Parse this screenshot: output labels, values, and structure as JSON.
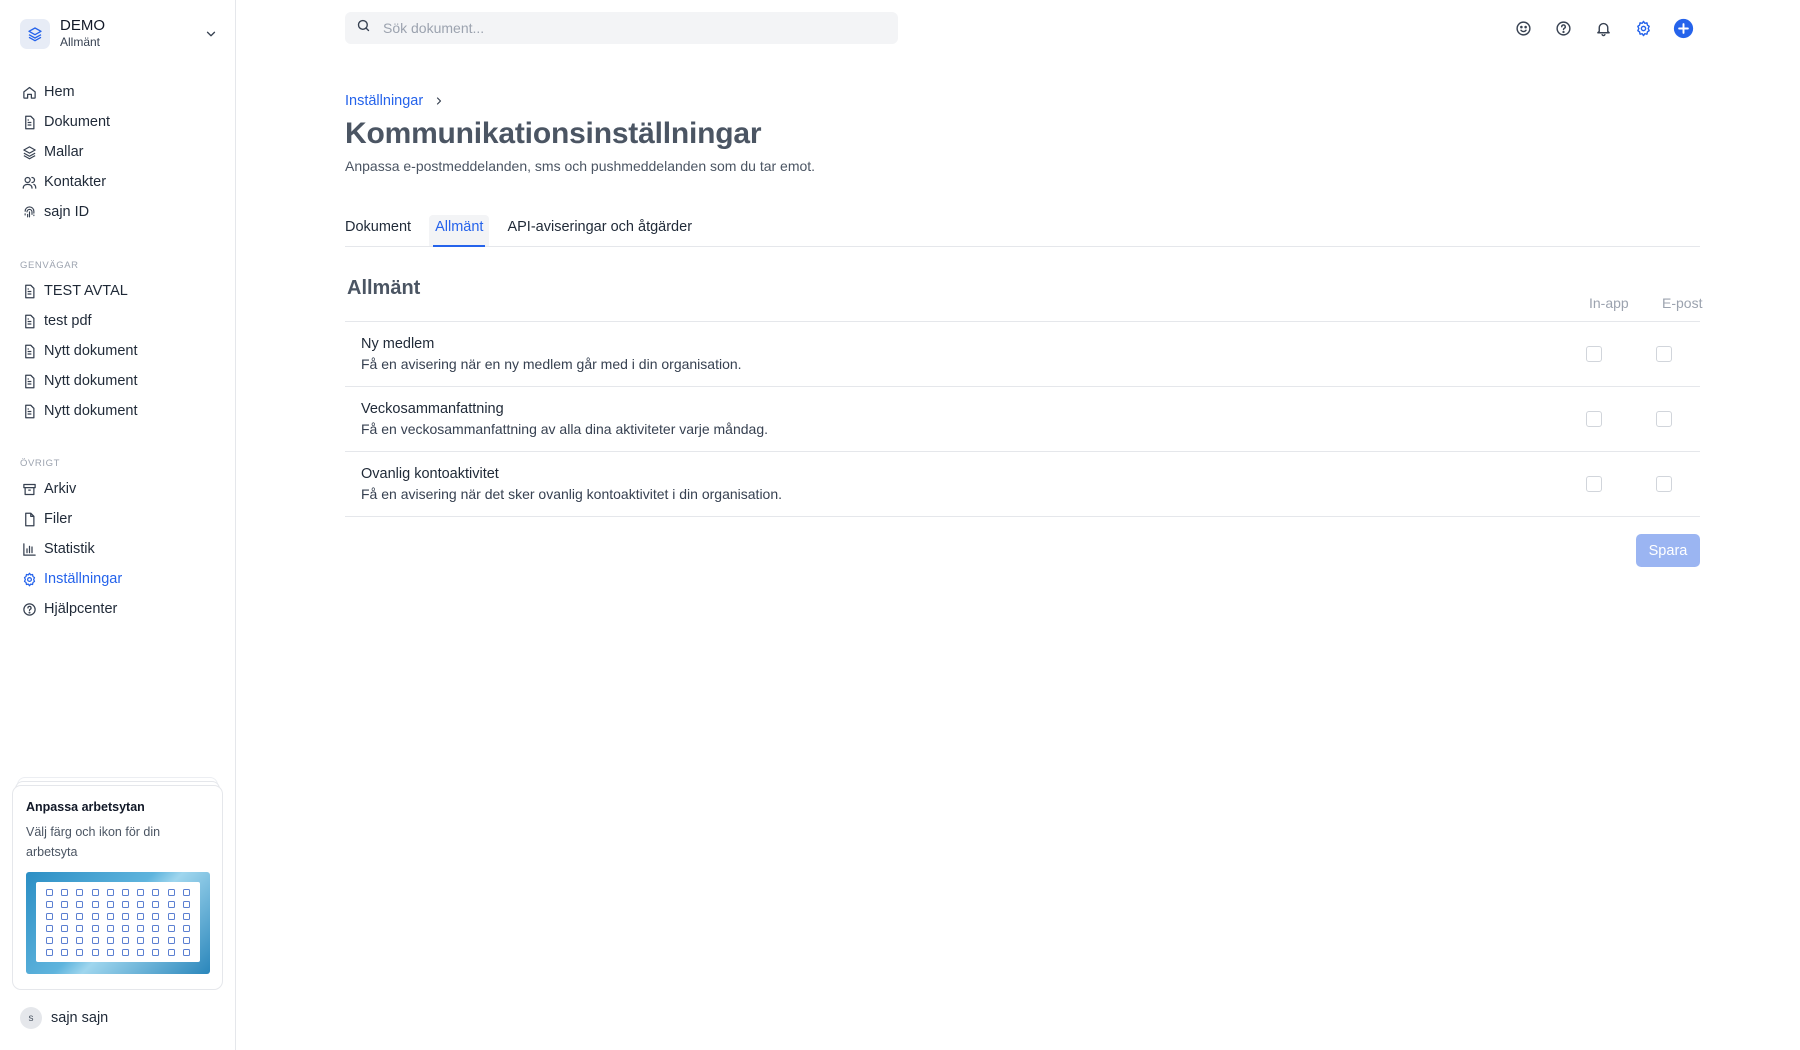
{
  "workspace": {
    "name": "DEMO",
    "subtitle": "Allmänt"
  },
  "nav": {
    "main": [
      {
        "label": "Hem",
        "icon": "home-icon"
      },
      {
        "label": "Dokument",
        "icon": "document-icon"
      },
      {
        "label": "Mallar",
        "icon": "layers-icon"
      },
      {
        "label": "Kontakter",
        "icon": "users-icon"
      },
      {
        "label": "sajn ID",
        "icon": "fingerprint-icon"
      }
    ],
    "shortcuts_label": "GENVÄGAR",
    "shortcuts": [
      {
        "label": "TEST AVTAL"
      },
      {
        "label": "test pdf"
      },
      {
        "label": "Nytt dokument"
      },
      {
        "label": "Nytt dokument"
      },
      {
        "label": "Nytt dokument"
      }
    ],
    "other_label": "ÖVRIGT",
    "other": [
      {
        "label": "Arkiv",
        "icon": "archive-icon"
      },
      {
        "label": "Filer",
        "icon": "file-icon"
      },
      {
        "label": "Statistik",
        "icon": "bar-chart-icon"
      },
      {
        "label": "Inställningar",
        "icon": "gear-icon",
        "active": true
      },
      {
        "label": "Hjälpcenter",
        "icon": "help-circle-icon"
      }
    ]
  },
  "promo": {
    "title": "Anpassa arbetsytan",
    "text": "Välj färg och ikon för din arbetsyta"
  },
  "user": {
    "initial": "s",
    "name": "sajn sajn"
  },
  "search": {
    "placeholder": "Sök dokument..."
  },
  "topbar_icons": [
    "smile-icon",
    "help-icon",
    "bell-icon",
    "gear-icon",
    "plus-circle-icon"
  ],
  "breadcrumb": {
    "parent": "Inställningar"
  },
  "page": {
    "title": "Kommunikationsinställningar",
    "subtitle": "Anpassa e-postmeddelanden, sms och pushmeddelanden som du tar emot."
  },
  "tabs": [
    {
      "label": "Dokument"
    },
    {
      "label": "Allmänt",
      "active": true
    },
    {
      "label": "API-aviseringar och åtgärder"
    }
  ],
  "section": {
    "title": "Allmänt",
    "columns": {
      "inapp": "In-app",
      "email": "E-post"
    },
    "rows": [
      {
        "title": "Ny medlem",
        "desc": "Få en avisering när en ny medlem går med i din organisation.",
        "inapp": false,
        "email": false
      },
      {
        "title": "Veckosammanfattning",
        "desc": "Få en veckosammanfattning av alla dina aktiviteter varje måndag.",
        "inapp": false,
        "email": false
      },
      {
        "title": "Ovanlig kontoaktivitet",
        "desc": "Få en avisering när det sker ovanlig kontoaktivitet i din organisation.",
        "inapp": false,
        "email": false
      }
    ]
  },
  "save_label": "Spara",
  "colors": {
    "accent": "#2563eb",
    "save_disabled": "#9bb5f2",
    "muted": "#9ca3af"
  }
}
